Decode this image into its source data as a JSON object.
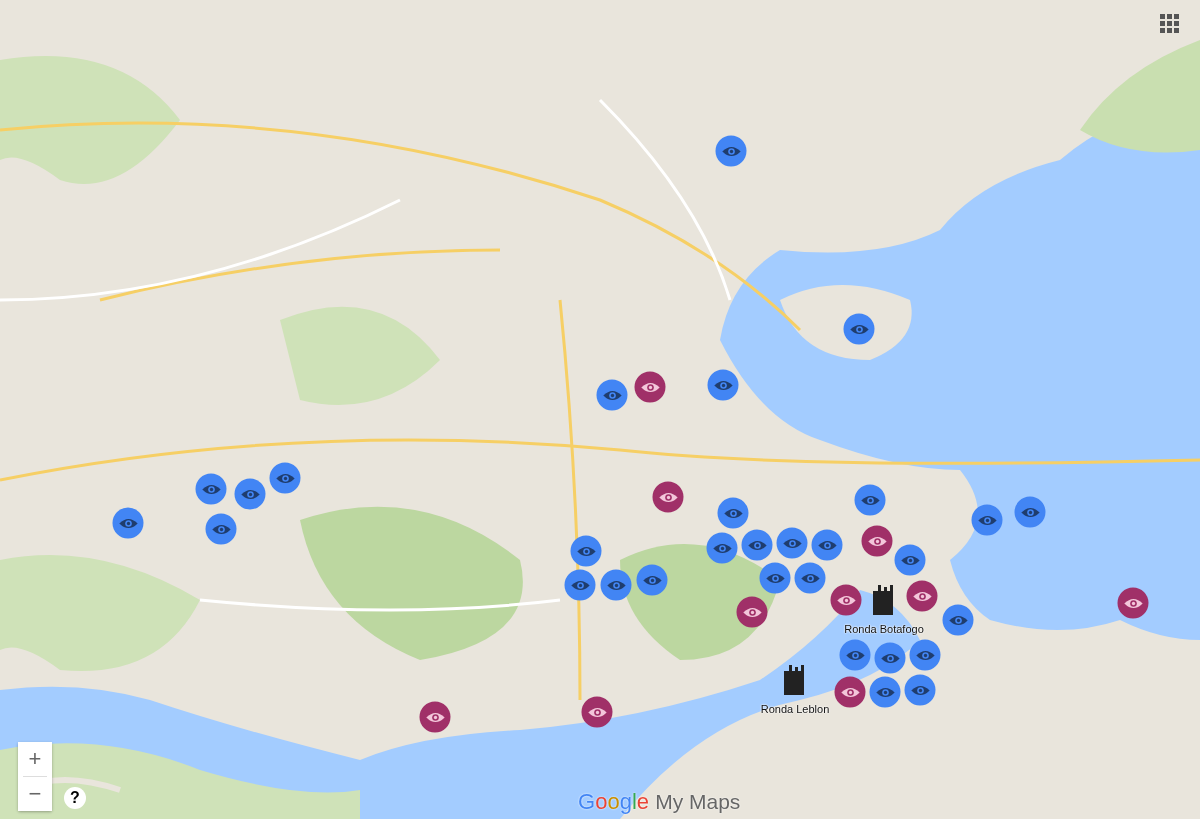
{
  "markers": [
    {
      "kind": "eye-blue"
    },
    {
      "kind": "eye-blue"
    },
    {
      "kind": "eye-blue"
    },
    {
      "kind": "eye-blue"
    },
    {
      "kind": "eye-blue"
    },
    {
      "kind": "eye-blue"
    },
    {
      "kind": "eye-blue"
    },
    {
      "kind": "eye-blue"
    },
    {
      "kind": "eye-blue"
    },
    {
      "kind": "eye-blue"
    },
    {
      "kind": "eye-blue"
    },
    {
      "kind": "eye-blue"
    },
    {
      "kind": "eye-blue"
    },
    {
      "kind": "eye-blue"
    },
    {
      "kind": "eye-blue"
    },
    {
      "kind": "eye-blue"
    },
    {
      "kind": "eye-blue"
    },
    {
      "kind": "eye-blue"
    },
    {
      "kind": "eye-blue"
    },
    {
      "kind": "eye-blue"
    },
    {
      "kind": "eye-blue"
    },
    {
      "kind": "eye-blue"
    },
    {
      "kind": "eye-blue"
    },
    {
      "kind": "eye-blue"
    },
    {
      "kind": "eye-blue"
    },
    {
      "kind": "eye-blue"
    },
    {
      "kind": "eye-blue"
    },
    {
      "kind": "eye-blue"
    },
    {
      "kind": "eye-blue"
    },
    {
      "kind": "eye-blue"
    },
    {
      "kind": "eye-purple"
    },
    {
      "kind": "eye-purple"
    },
    {
      "kind": "eye-purple"
    },
    {
      "kind": "eye-purple"
    },
    {
      "kind": "eye-purple"
    },
    {
      "kind": "eye-purple"
    },
    {
      "kind": "eye-purple"
    },
    {
      "kind": "eye-purple"
    },
    {
      "kind": "eye-purple"
    },
    {
      "kind": "eye-purple"
    },
    {
      "kind": "building",
      "label": "Ronda Botafogo"
    },
    {
      "kind": "building",
      "label": "Ronda Leblon"
    }
  ],
  "zoom": {
    "in": "+",
    "out": "−"
  },
  "help": "?",
  "logo": {
    "brand": "Google",
    "product": "My Maps"
  }
}
